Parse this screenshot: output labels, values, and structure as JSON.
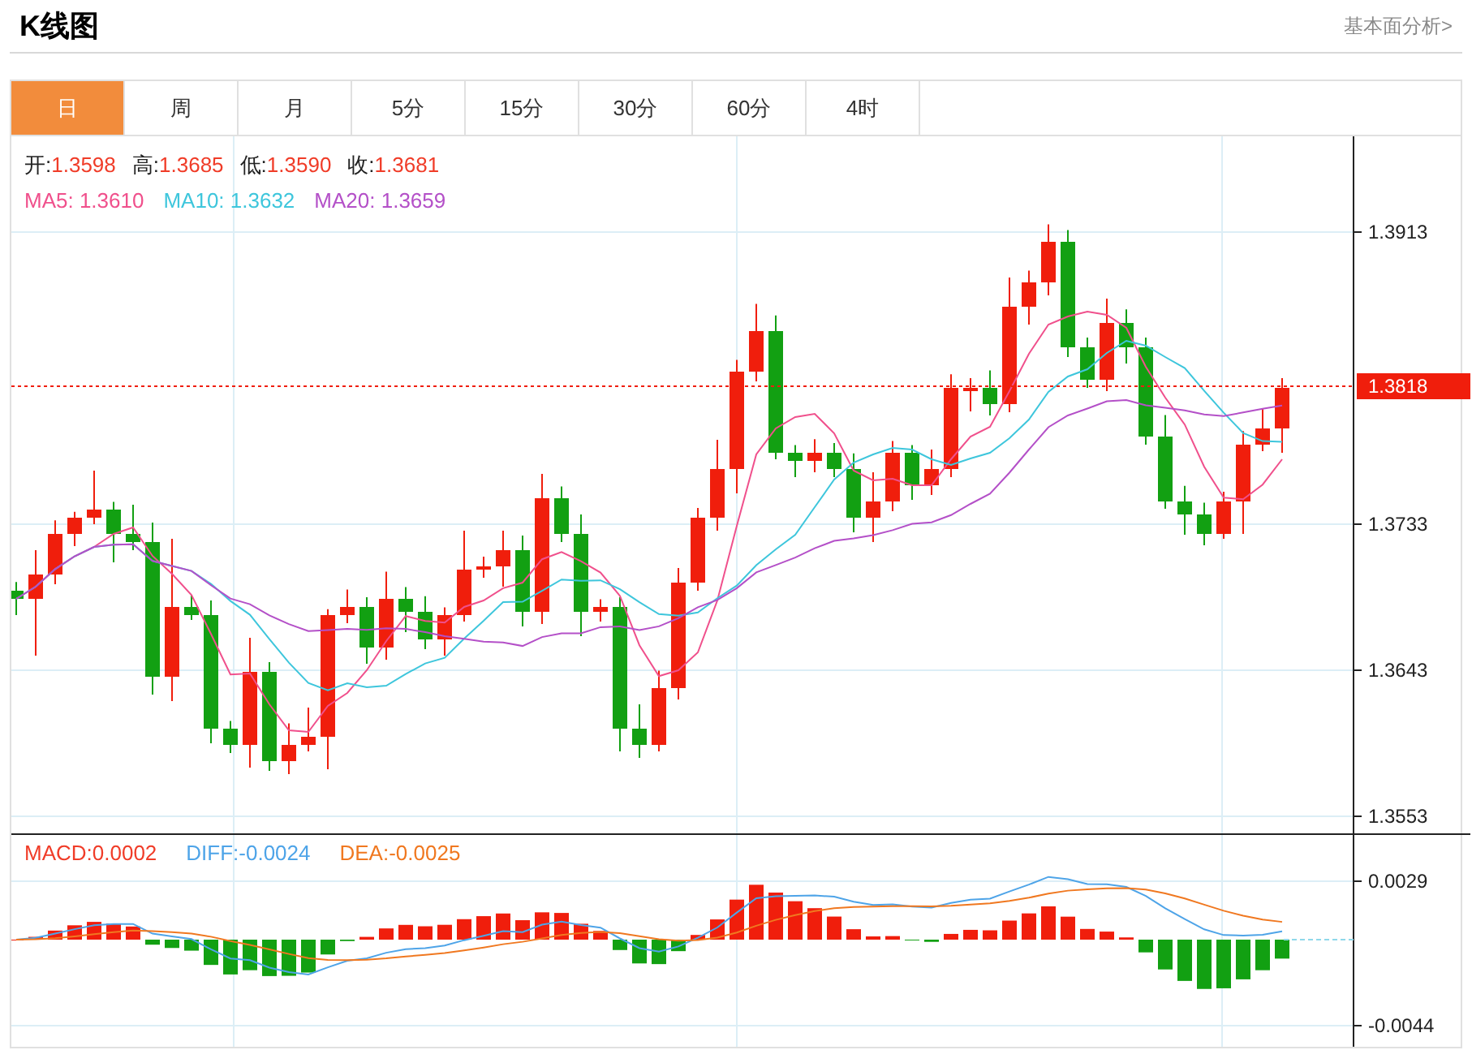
{
  "header": {
    "title": "K线图",
    "link": "基本面分析>"
  },
  "tabs": [
    {
      "label": "日",
      "selected": true
    },
    {
      "label": "周",
      "selected": false
    },
    {
      "label": "月",
      "selected": false
    },
    {
      "label": "5分",
      "selected": false
    },
    {
      "label": "15分",
      "selected": false
    },
    {
      "label": "30分",
      "selected": false
    },
    {
      "label": "60分",
      "selected": false
    },
    {
      "label": "4时",
      "selected": false
    }
  ],
  "ohlc_legend": [
    {
      "label": "开:",
      "value": "1.3598"
    },
    {
      "label": "高:",
      "value": "1.3685"
    },
    {
      "label": "低:",
      "value": "1.3590"
    },
    {
      "label": "收:",
      "value": "1.3681"
    }
  ],
  "ma_legend": [
    {
      "label": "MA5:",
      "value": "1.3610",
      "color": "#f0508c"
    },
    {
      "label": "MA10:",
      "value": "1.3632",
      "color": "#3ec6dc"
    },
    {
      "label": "MA20:",
      "value": "1.3659",
      "color": "#b450c8"
    }
  ],
  "price_axis": [
    "1.3913",
    "1.3733",
    "1.3643",
    "1.3553"
  ],
  "current_price": "1.3818",
  "macd_legend": [
    {
      "label": "MACD:",
      "value": "0.0002",
      "color": "#f03c28"
    },
    {
      "label": "DIFF:",
      "value": "-0.0024",
      "color": "#4ea4e8"
    },
    {
      "label": "DEA:",
      "value": "-0.0025",
      "color": "#f07820"
    }
  ],
  "macd_axis": [
    "0.0029",
    "-0.0044"
  ]
}
